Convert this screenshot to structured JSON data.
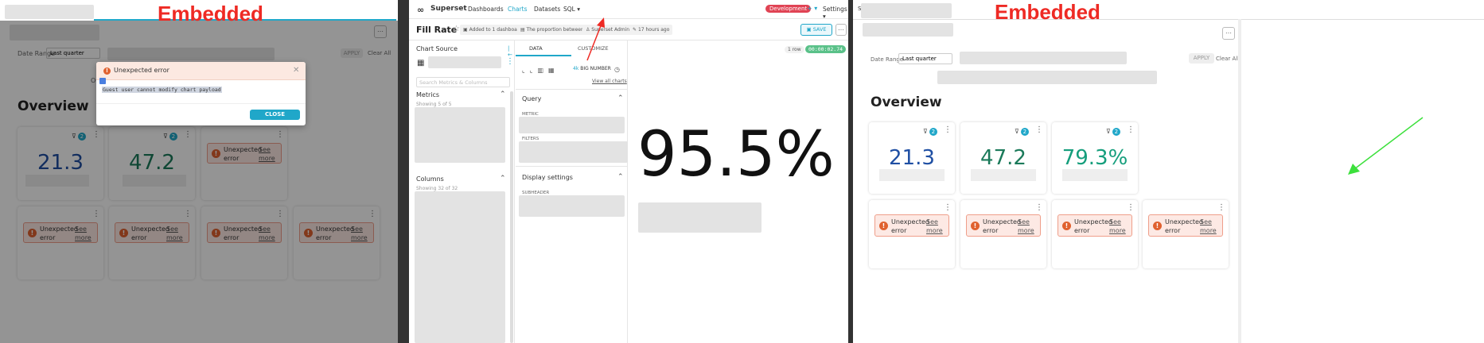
{
  "labels": {
    "embedded_left": "Embedded",
    "embedded_right": "Embedded"
  },
  "left": {
    "date_range_label": "Date Range",
    "date_range_value": "Last quarter",
    "apply": "APPLY",
    "clear_all": "Clear All",
    "overview": "Overview",
    "stray_text": "O",
    "values": [
      "21.3",
      "47.2"
    ],
    "filter_counts": [
      "2",
      "2"
    ],
    "error_title": "Unexpected error",
    "see_more": "See more",
    "modal": {
      "title": "Unexpected error",
      "message": "Guest user cannot modify chart payload",
      "close": "CLOSE"
    }
  },
  "middle": {
    "brand": "Superset",
    "nav": [
      "Dashboards",
      "Charts",
      "Datasets",
      "SQL"
    ],
    "env_badge": "Development",
    "plus": "+",
    "settings": "Settings",
    "chart_title": "Fill Rate",
    "meta": [
      "Added to 1 dashboard",
      "The proportion between...",
      "Superset Admin",
      "17 hours ago"
    ],
    "save": "SAVE",
    "chart_source": "Chart Source",
    "search_placeholder": "Search Metrics & Columns",
    "metrics": "Metrics",
    "metrics_count": "Showing 5 of 5",
    "columns": "Columns",
    "columns_count": "Showing 32 of 32",
    "tabs": [
      "DATA",
      "CUSTOMIZE"
    ],
    "viz_name": "BIG NUMBER",
    "view_all": "View all charts",
    "query": "Query",
    "metric": "METRIC",
    "filters": "FILTERS",
    "display_settings": "Display settings",
    "subheader": "SUBHEADER",
    "row_count": "1 row",
    "timer": "00:00:02.74",
    "big_value": "95.5%"
  },
  "right": {
    "date_range_label": "Date Range",
    "date_range_value": "Last quarter",
    "apply": "APPLY",
    "clear_all": "Clear All",
    "overview": "Overview",
    "values": [
      "21.3",
      "47.2",
      "79.3%"
    ],
    "filter_counts": [
      "2",
      "2",
      "2"
    ],
    "error_title": "Unexpected error",
    "see_more": "See more",
    "tab_text": "Su"
  },
  "colors": {
    "blue": "#1f4fa3",
    "green": "#1b7a5a",
    "teal": "#159e7c",
    "accent": "#20a7c9",
    "red": "#ee2a24"
  }
}
